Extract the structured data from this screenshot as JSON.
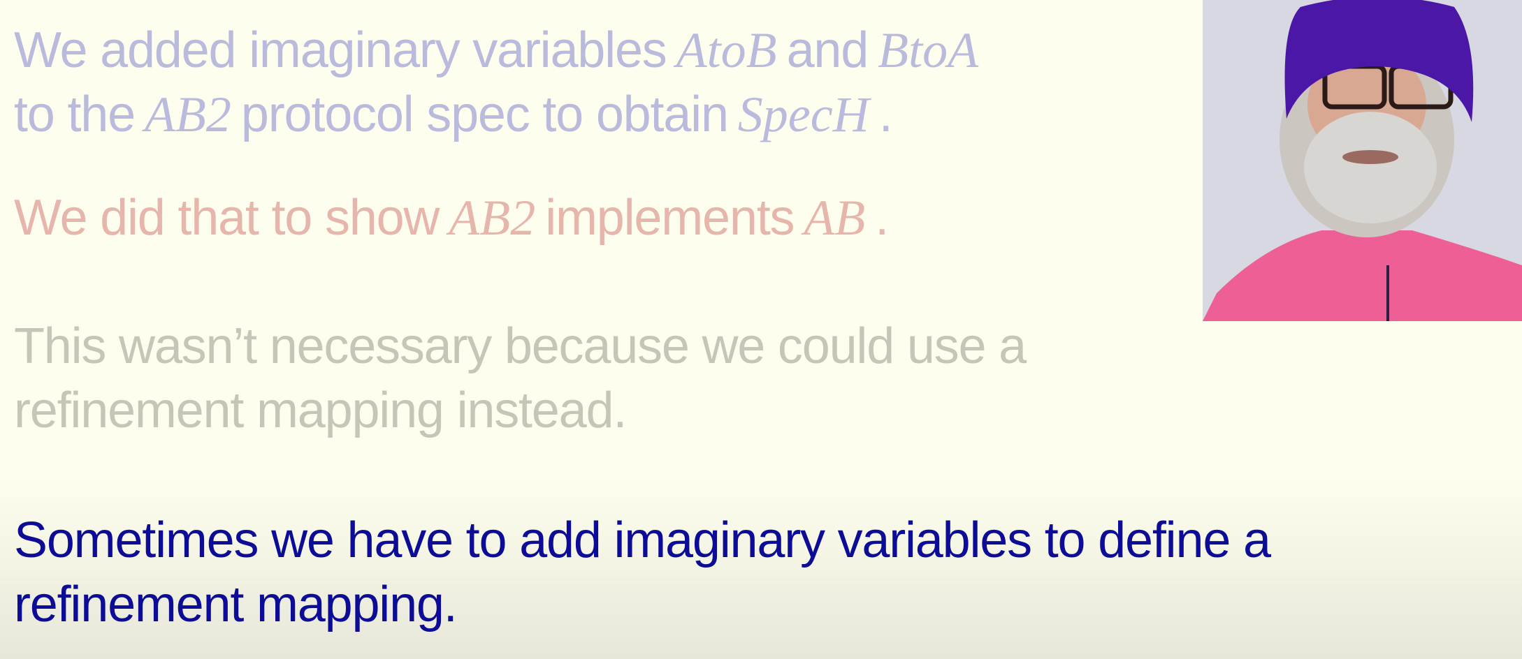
{
  "slide": {
    "p1": {
      "l1_a": "We added imaginary variables",
      "m_atob": "AtoB",
      "l1_b": "and",
      "m_btoa": "BtoA",
      "l2_a": "to the",
      "m_ab2": "AB2",
      "l2_b": "protocol spec to obtain",
      "m_spech": "SpecH",
      "l2_c": "."
    },
    "p2": {
      "a": "We did that to show",
      "m_ab2": "AB2",
      "b": "implements",
      "m_ab": "AB",
      "c": "."
    },
    "p3": {
      "l1": "This wasn’t necessary because we could use a",
      "l2": "refinement mapping instead."
    },
    "p4": {
      "l1": "Sometimes we have to add imaginary variables to define a",
      "l2": "refinement mapping."
    }
  },
  "colors": {
    "p1": "#b9badc",
    "p2": "#e6b6ac",
    "p3": "#c6c6b8",
    "p4": "#0c0c96",
    "background": "#fefeee"
  }
}
